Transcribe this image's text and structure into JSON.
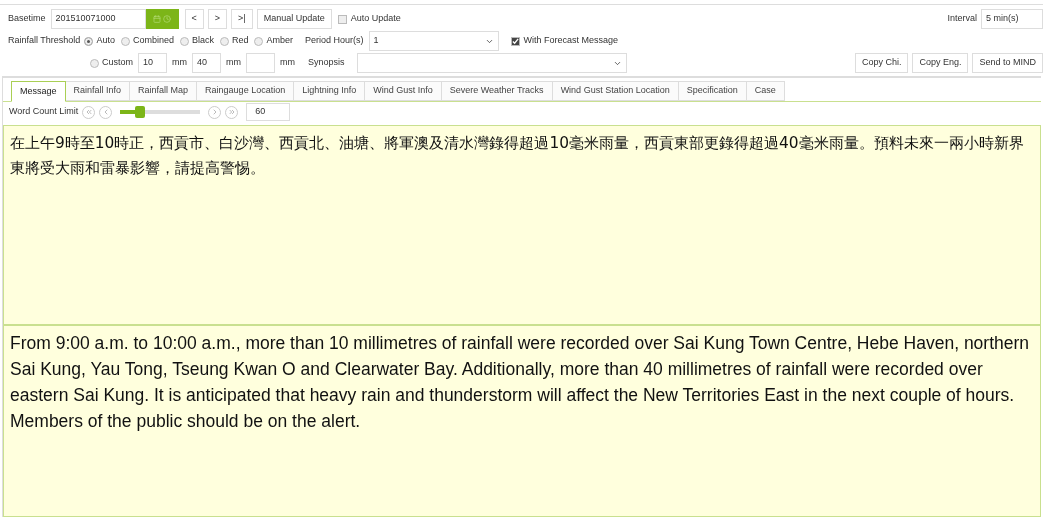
{
  "basetime": {
    "label": "Basetime",
    "value": "201510071000"
  },
  "nav_buttons": [
    "<",
    ">",
    ">|"
  ],
  "manual_update": "Manual Update",
  "auto_update": {
    "label": "Auto Update",
    "checked": false
  },
  "interval": {
    "label": "Interval",
    "value": "5 min(s)"
  },
  "rainfall_threshold": {
    "label": "Rainfall Threshold",
    "options": [
      {
        "label": "Auto",
        "selected": true
      },
      {
        "label": "Combined",
        "selected": false
      },
      {
        "label": "Black",
        "selected": false
      },
      {
        "label": "Red",
        "selected": false
      },
      {
        "label": "Amber",
        "selected": false
      }
    ]
  },
  "period_hours": {
    "label": "Period Hour(s)",
    "value": "1"
  },
  "with_forecast": {
    "label": "With Forecast Message",
    "checked": true
  },
  "custom": {
    "label": "Custom",
    "selected": false,
    "fields": [
      {
        "value": "10",
        "unit": "mm"
      },
      {
        "value": "40",
        "unit": "mm"
      },
      {
        "unit": "mm"
      }
    ]
  },
  "synopsis": {
    "label": "Synopsis"
  },
  "action_buttons": [
    "Copy Chi.",
    "Copy Eng.",
    "Send to MIND"
  ],
  "tabs": [
    {
      "label": "Message",
      "selected": true
    },
    {
      "label": "Rainfall Info",
      "selected": false
    },
    {
      "label": "Rainfall Map",
      "selected": false
    },
    {
      "label": "Raingauge Location",
      "selected": false
    },
    {
      "label": "Lightning Info",
      "selected": false
    },
    {
      "label": "Wind Gust Info",
      "selected": false
    },
    {
      "label": "Severe Weather Tracks",
      "selected": false
    },
    {
      "label": "Wind Gust Station Location",
      "selected": false
    },
    {
      "label": "Specification",
      "selected": false
    },
    {
      "label": "Case",
      "selected": false
    }
  ],
  "word_count": {
    "label": "Word Count Limit",
    "level": 0.25,
    "value": "60"
  },
  "message_chinese": "在上午9時至10時正，西貢市、白沙灣、西貢北、油塘、將軍澳及清水灣錄得超過10毫米雨量，西貢東部更錄得超過40毫米雨量。預料未來一兩小時新界東將受大雨和雷暴影響，請提高警惕。",
  "message_english": "From 9:00 a.m. to 10:00 a.m., more than 10 millimetres of rainfall were recorded over Sai Kung Town Centre, Hebe Haven, northern Sai Kung, Yau Tong, Tseung Kwan O and Clearwater Bay. Additionally, more than 40 millimetres of rainfall were recorded over eastern Sai Kung. It is anticipated that heavy rain and thunderstorm will affect the New Territories East in the next couple of hours. Members of the public should be on the alert."
}
